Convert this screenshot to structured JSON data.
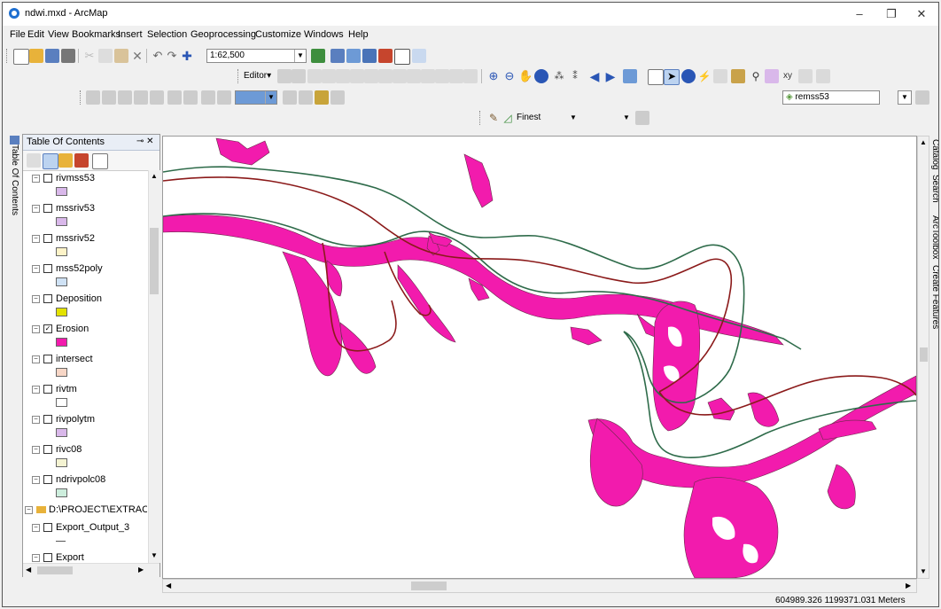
{
  "window": {
    "title": "ndwi.mxd - ArcMap",
    "minimize": "–",
    "restore": "❐",
    "close": "✕"
  },
  "menu": [
    "File",
    "Edit",
    "View",
    "Bookmarks",
    "Insert",
    "Selection",
    "Geoprocessing",
    "Customize",
    "Windows",
    "Help"
  ],
  "toolbar": {
    "scale": "1:62,500",
    "editor_label": "Editor▾",
    "target_layer": "remss53",
    "smoothing": "Finest"
  },
  "toc": {
    "title": "Table Of Contents",
    "pin": "⊸ ✕",
    "side_tab": "Table Of Contents",
    "layers": [
      {
        "name": "rivmss53",
        "checked": false,
        "color": "#d9b8ea"
      },
      {
        "name": "mssriv53",
        "checked": false,
        "color": "#d9b8ea"
      },
      {
        "name": "mssriv52",
        "checked": false,
        "color": "#fdf3c8"
      },
      {
        "name": "mss52poly",
        "checked": false,
        "color": "#cfe2f5"
      },
      {
        "name": "Deposition",
        "checked": false,
        "color": "#e3e200"
      },
      {
        "name": "Erosion",
        "checked": true,
        "color": "#f21bad"
      },
      {
        "name": "intersect",
        "checked": false,
        "color": "#f7d6c6"
      },
      {
        "name": "rivtm",
        "checked": false,
        "color": "#ffffff"
      },
      {
        "name": "rivpolytm",
        "checked": false,
        "color": "#d9b8ea"
      },
      {
        "name": "rivc08",
        "checked": false,
        "color": "#f4f3d2"
      },
      {
        "name": "ndrivpolc08",
        "checked": false,
        "color": "#cdeedd"
      }
    ],
    "group": "D:\\PROJECT\\EXTRACT",
    "group_layers": [
      {
        "name": "Export_Output_3",
        "checked": false
      },
      {
        "name": "Export",
        "checked": false
      }
    ]
  },
  "right_tabs": [
    "Catalog",
    "Search",
    "ArcToolbox",
    "Create Features"
  ],
  "status": {
    "coordinates": "604989.326  1199371.031 Meters"
  },
  "colors": {
    "erosion": "#f21bad",
    "river_green": "#2e6b4a",
    "river_red": "#8b1a1a"
  }
}
